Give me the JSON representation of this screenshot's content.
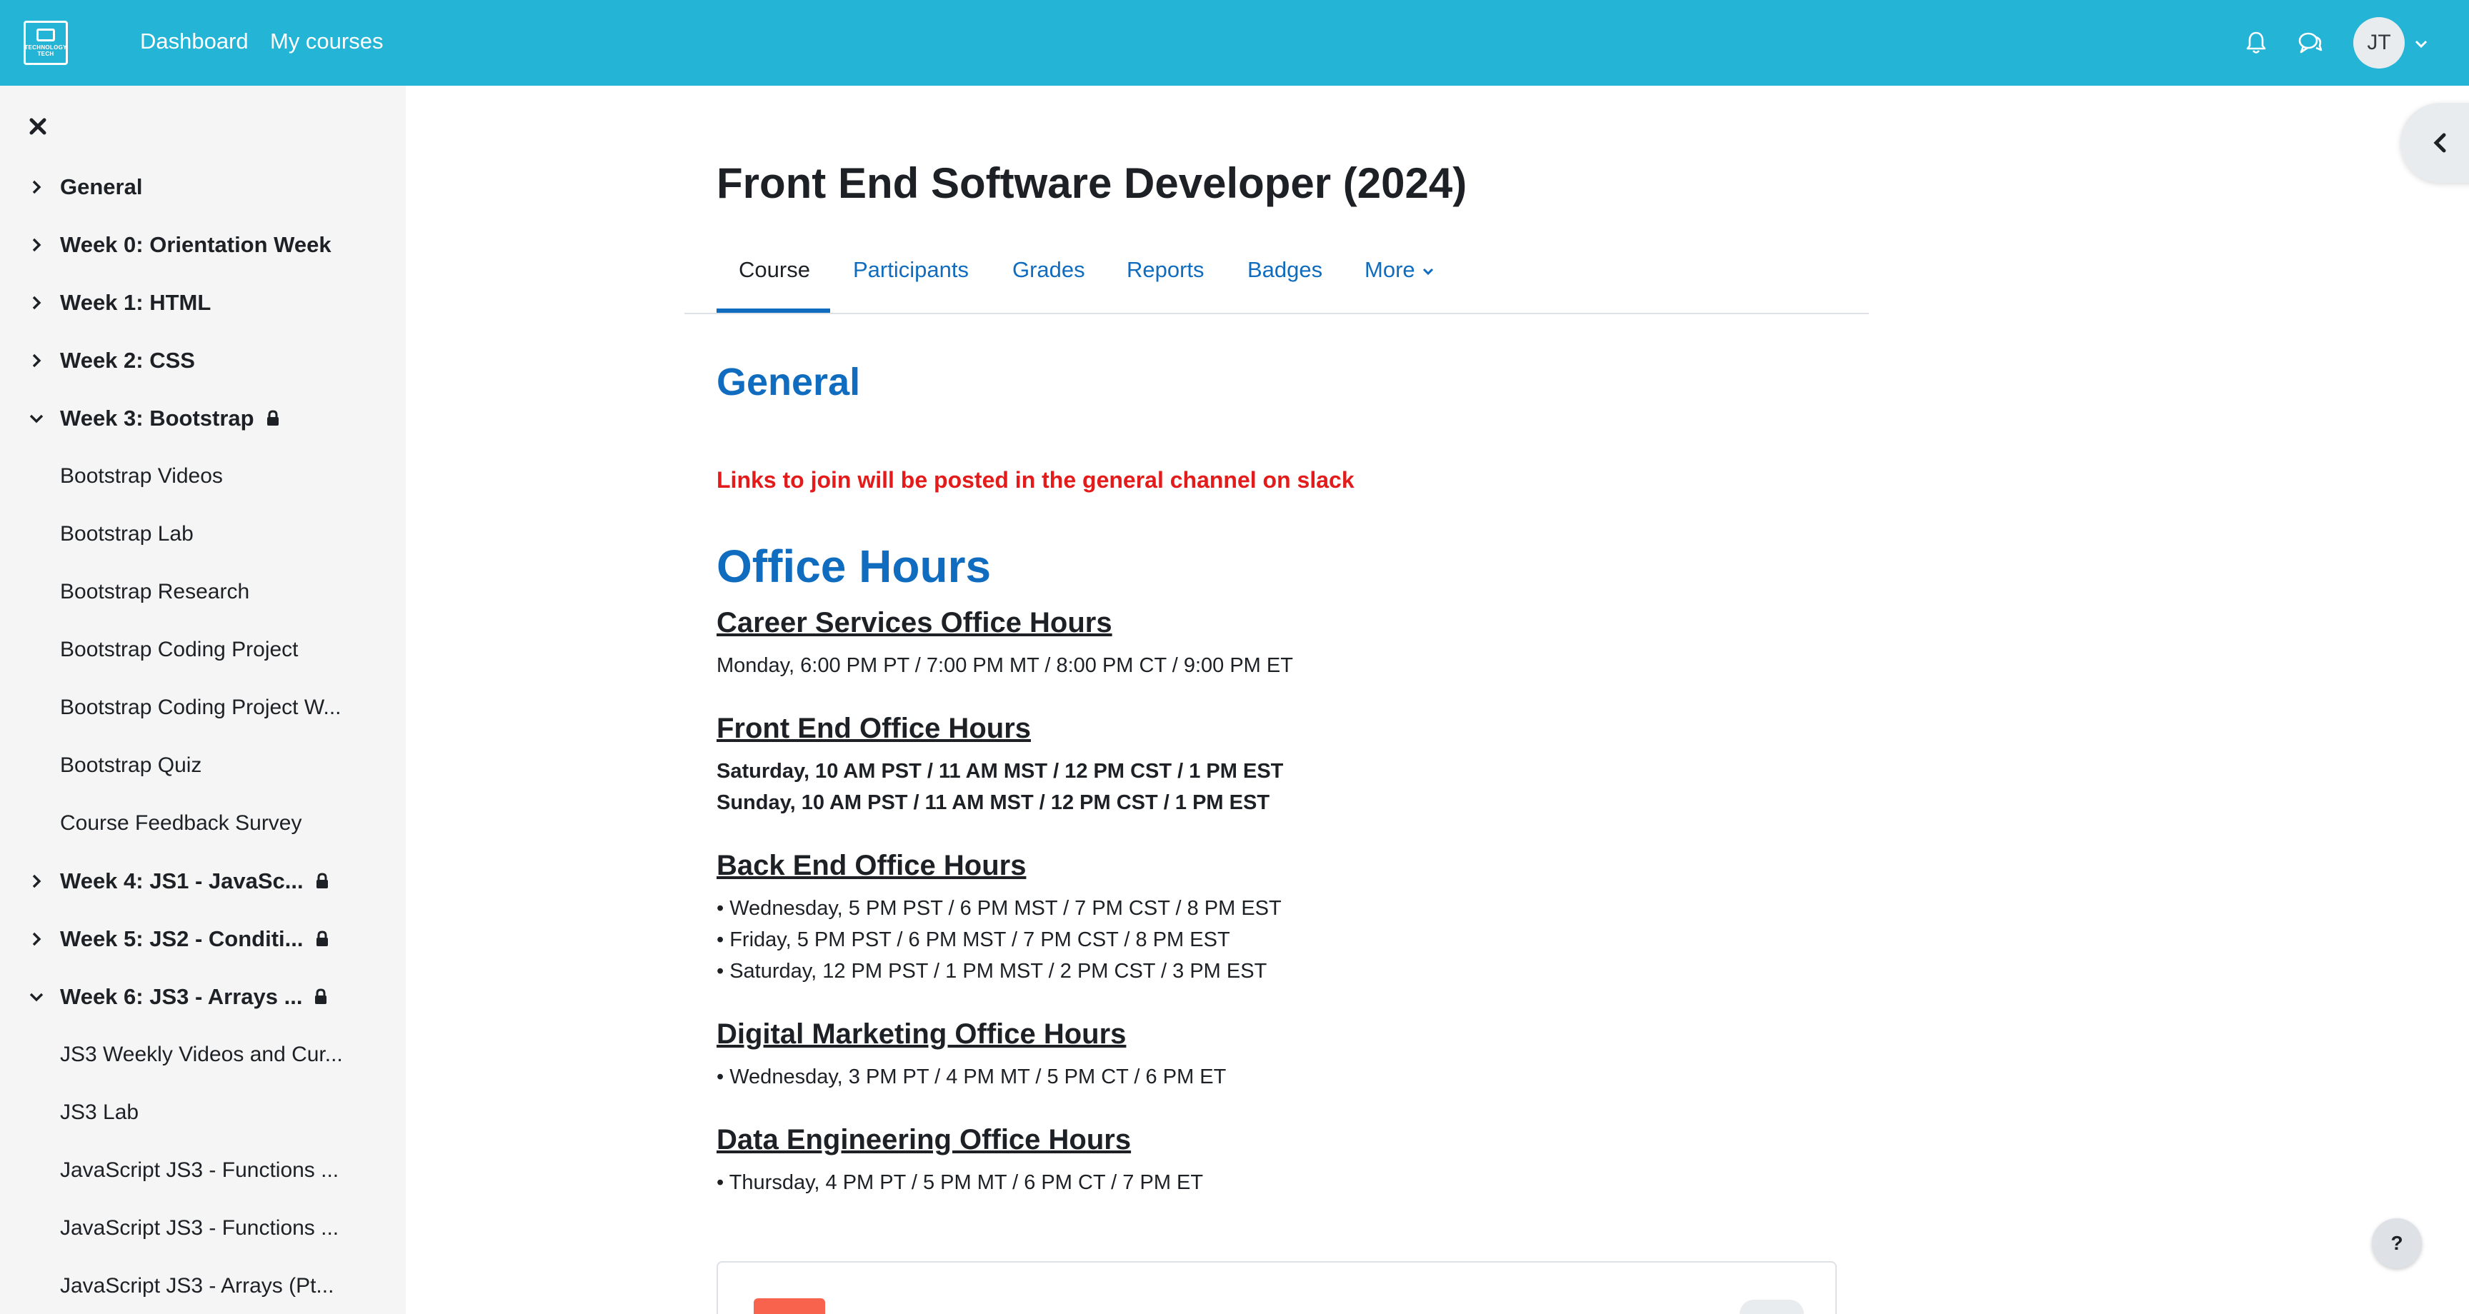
{
  "topbar": {
    "logo_text": "TECHNOLOGY TECH",
    "nav": [
      "Dashboard",
      "My courses"
    ],
    "avatar_initials": "JT",
    "bg_color": "#24b4d6"
  },
  "sidebar": {
    "items": [
      {
        "label": "General",
        "type": "section",
        "expanded": false,
        "locked": false
      },
      {
        "label": "Week 0: Orientation Week",
        "type": "section",
        "expanded": false,
        "locked": false
      },
      {
        "label": "Week 1: HTML",
        "type": "section",
        "expanded": false,
        "locked": false
      },
      {
        "label": "Week 2: CSS",
        "type": "section",
        "expanded": false,
        "locked": false
      },
      {
        "label": "Week 3: Bootstrap",
        "type": "section",
        "expanded": true,
        "locked": true
      },
      {
        "label": "Bootstrap Videos",
        "type": "activity"
      },
      {
        "label": "Bootstrap Lab",
        "type": "activity"
      },
      {
        "label": "Bootstrap Research",
        "type": "activity"
      },
      {
        "label": "Bootstrap Coding Project",
        "type": "activity"
      },
      {
        "label": "Bootstrap Coding Project W...",
        "type": "activity"
      },
      {
        "label": "Bootstrap Quiz",
        "type": "activity"
      },
      {
        "label": "Course Feedback Survey",
        "type": "activity"
      },
      {
        "label": "Week 4: JS1 - JavaSc...",
        "type": "section",
        "expanded": false,
        "locked": true
      },
      {
        "label": "Week 5: JS2 - Conditi...",
        "type": "section",
        "expanded": false,
        "locked": true
      },
      {
        "label": "Week 6: JS3 - Arrays ...",
        "type": "section",
        "expanded": true,
        "locked": true
      },
      {
        "label": "JS3 Weekly Videos and Cur...",
        "type": "activity"
      },
      {
        "label": "JS3 Lab",
        "type": "activity"
      },
      {
        "label": "JavaScript JS3 - Functions ...",
        "type": "activity"
      },
      {
        "label": "JavaScript JS3 - Functions ...",
        "type": "activity"
      },
      {
        "label": "JavaScript JS3 - Arrays (Pt...",
        "type": "activity"
      }
    ]
  },
  "course": {
    "title": "Front End Software Developer (2024)",
    "tabs": [
      "Course",
      "Participants",
      "Grades",
      "Reports",
      "Badges",
      "More"
    ],
    "active_tab": "Course"
  },
  "main": {
    "section_heading": "General",
    "red_note": "Links to join will be posted in the general channel on slack",
    "office_hours_title": "Office Hours",
    "groups": [
      {
        "title": "Career Services Office Hours",
        "lines": [
          "Monday, 6:00 PM PT / 7:00 PM MT / 8:00 PM CT / 9:00 PM ET"
        ],
        "bold": false
      },
      {
        "title": "Front End Office Hours",
        "lines": [
          "Saturday, 10 AM PST / 11 AM MST / 12 PM CST / 1 PM EST",
          "Sunday, 10 AM PST / 11 AM MST / 12 PM CST / 1 PM EST"
        ],
        "bold": true
      },
      {
        "title": "Back End Office Hours",
        "lines": [
          "• Wednesday, 5 PM PST / 6 PM MST / 7 PM CST / 8 PM EST",
          "• Friday, 5 PM PST / 6 PM MST / 7 PM CST / 8 PM EST",
          "• Saturday, 12 PM PST / 1 PM MST / 2 PM CST / 3 PM EST"
        ],
        "bold": false
      },
      {
        "title": "Digital Marketing Office Hours",
        "lines": [
          "• Wednesday, 3 PM PT / 4 PM MT / 5 PM CT / 6 PM ET"
        ],
        "bold": false
      },
      {
        "title": "Data Engineering Office Hours",
        "lines": [
          "• Thursday, 4 PM PT / 5 PM MT / 6 PM CT / 7 PM ET"
        ],
        "bold": false
      }
    ]
  },
  "help_label": "?",
  "colors": {
    "link": "#0f6cbf",
    "warning": "#e41b1b",
    "sidebar_bg": "#f5f5f5"
  }
}
